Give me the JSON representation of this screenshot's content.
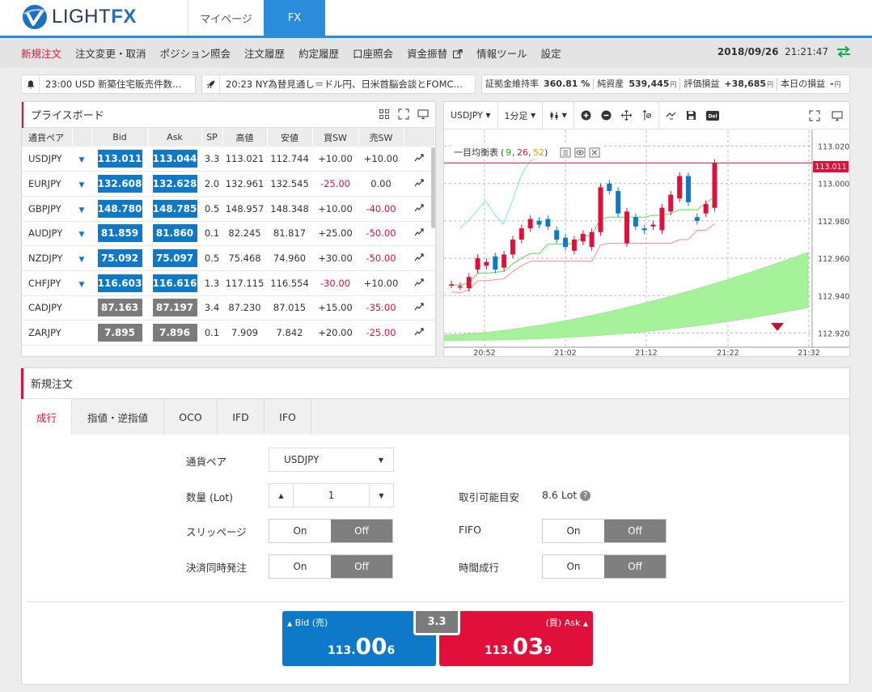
{
  "header": {
    "logo_text": "LIGHT",
    "logo_text_bold": "FX",
    "tabs": [
      {
        "label": "マイページ"
      },
      {
        "label": "FX"
      }
    ]
  },
  "nav": {
    "items": [
      "新規注文",
      "注文変更・取消",
      "ポジション照会",
      "注文履歴",
      "約定履歴",
      "口座照会",
      "資金振替",
      "情報ツール",
      "設定"
    ],
    "date": "2018/09/26",
    "time": "21:21:47"
  },
  "ticker": [
    {
      "text": "23:00 USD 新築住宅販売件数…"
    },
    {
      "text": "20:23 NY為替見通し＝ドル円、日米首脳会談とFOMC…"
    }
  ],
  "stats": {
    "margin_label": "証拠金維持率",
    "margin_value": "360.81 %",
    "equity_label": "純資産",
    "equity_value": "539,445",
    "equity_unit": "円",
    "pl_label": "評価損益",
    "pl_value": "+38,685",
    "pl_unit": "円",
    "today_label": "本日の損益",
    "today_value": "-",
    "today_unit": "円"
  },
  "price_board": {
    "title": "プライスボード",
    "columns": [
      "通貨ペア",
      "",
      "Bid",
      "Ask",
      "SP",
      "高値",
      "安値",
      "買SW",
      "売SW",
      ""
    ],
    "rows": [
      {
        "pair": "USDJPY",
        "arrow": true,
        "bid": "113.011",
        "ask": "113.044",
        "sp": "3.3",
        "high": "113.021",
        "low": "112.744",
        "buy_sw": "+10.00",
        "sell_sw": "+10.00",
        "active": true,
        "neg_buy": false,
        "neg_sell": false
      },
      {
        "pair": "EURJPY",
        "arrow": true,
        "bid": "132.608",
        "ask": "132.628",
        "sp": "2.0",
        "high": "132.961",
        "low": "132.545",
        "buy_sw": "-25.00",
        "sell_sw": "0.00",
        "active": true,
        "neg_buy": true,
        "neg_sell": false
      },
      {
        "pair": "GBPJPY",
        "arrow": true,
        "bid": "148.780",
        "ask": "148.785",
        "sp": "0.5",
        "high": "148.957",
        "low": "148.348",
        "buy_sw": "+10.00",
        "sell_sw": "-40.00",
        "active": true,
        "neg_buy": false,
        "neg_sell": true
      },
      {
        "pair": "AUDJPY",
        "arrow": true,
        "bid": "81.859",
        "ask": "81.860",
        "sp": "0.1",
        "high": "82.245",
        "low": "81.817",
        "buy_sw": "+25.00",
        "sell_sw": "-50.00",
        "active": true,
        "neg_buy": false,
        "neg_sell": true
      },
      {
        "pair": "NZDJPY",
        "arrow": true,
        "bid": "75.092",
        "ask": "75.097",
        "sp": "0.5",
        "high": "75.468",
        "low": "74.960",
        "buy_sw": "+30.00",
        "sell_sw": "-50.00",
        "active": true,
        "neg_buy": false,
        "neg_sell": true
      },
      {
        "pair": "CHFJPY",
        "arrow": true,
        "bid": "116.603",
        "ask": "116.616",
        "sp": "1.3",
        "high": "117.115",
        "low": "116.554",
        "buy_sw": "-30.00",
        "sell_sw": "+10.00",
        "active": true,
        "neg_buy": true,
        "neg_sell": false
      },
      {
        "pair": "CADJPY",
        "arrow": false,
        "bid": "87.163",
        "ask": "87.197",
        "sp": "3.4",
        "high": "87.230",
        "low": "87.015",
        "buy_sw": "+15.00",
        "sell_sw": "-35.00",
        "active": false,
        "neg_buy": false,
        "neg_sell": true
      },
      {
        "pair": "ZARJPY",
        "arrow": false,
        "bid": "7.895",
        "ask": "7.896",
        "sp": "0.1",
        "high": "7.909",
        "low": "7.842",
        "buy_sw": "+20.00",
        "sell_sw": "-25.00",
        "active": false,
        "neg_buy": false,
        "neg_sell": true
      }
    ]
  },
  "chart": {
    "symbol": "USDJPY",
    "timeframe": "1分足",
    "indicator_name": "一目均衡表",
    "indicator_params": [
      "9",
      "26",
      "52"
    ],
    "y_ticks": [
      "113.020",
      "113.000",
      "112.980",
      "112.960",
      "112.940",
      "112.920"
    ],
    "x_ticks": [
      "20:52",
      "21:02",
      "21:12",
      "21:22",
      "21:32"
    ],
    "current_price": "113.011",
    "ylim": [
      112.915,
      113.025
    ],
    "candles": [
      {
        "o": 112.946,
        "c": 112.946
      },
      {
        "o": 112.945,
        "c": 112.945
      },
      {
        "o": 112.944,
        "c": 112.95
      },
      {
        "o": 112.954,
        "c": 112.96
      },
      {
        "o": 112.956,
        "c": 112.958
      },
      {
        "o": 112.961,
        "c": 112.954
      },
      {
        "o": 112.955,
        "c": 112.962
      },
      {
        "o": 112.962,
        "c": 112.97
      },
      {
        "o": 112.97,
        "c": 112.976
      },
      {
        "o": 112.976,
        "c": 112.981
      },
      {
        "o": 112.98,
        "c": 112.978
      },
      {
        "o": 112.981,
        "c": 112.977
      },
      {
        "o": 112.975,
        "c": 112.97
      },
      {
        "o": 112.971,
        "c": 112.966
      },
      {
        "o": 112.964,
        "c": 112.97
      },
      {
        "o": 112.969,
        "c": 112.973
      },
      {
        "o": 112.966,
        "c": 112.974
      },
      {
        "o": 112.974,
        "c": 112.998
      },
      {
        "o": 113.0,
        "c": 112.996
      },
      {
        "o": 112.996,
        "c": 112.984
      },
      {
        "o": 112.968,
        "c": 112.985
      },
      {
        "o": 112.982,
        "c": 112.977
      },
      {
        "o": 112.976,
        "c": 112.975
      },
      {
        "o": 112.977,
        "c": 112.978
      },
      {
        "o": 112.975,
        "c": 112.987
      },
      {
        "o": 112.985,
        "c": 112.994
      },
      {
        "o": 112.992,
        "c": 113.004
      },
      {
        "o": 113.004,
        "c": 112.99
      },
      {
        "o": 112.982,
        "c": 112.98
      },
      {
        "o": 112.984,
        "c": 112.989
      },
      {
        "o": 112.987,
        "c": 113.011
      }
    ]
  },
  "order": {
    "title": "新規注文",
    "tabs": [
      "成行",
      "指値・逆指値",
      "OCO",
      "IFD",
      "IFO"
    ],
    "pair_label": "通貨ペア",
    "pair_value": "USDJPY",
    "qty_label": "数量 (Lot)",
    "qty_value": "1",
    "avail_label": "取引可能目安",
    "avail_value": "8.6 Lot",
    "slippage_label": "スリッページ",
    "fifo_label": "FIFO",
    "settle_label": "決済同時発注",
    "time_label": "時間成行",
    "on_label": "On",
    "off_label": "Off",
    "bid_caption": "Bid (売)",
    "ask_caption": "(買) Ask",
    "bid_price": [
      "113.",
      "00",
      "6"
    ],
    "ask_price": [
      "113.",
      "03",
      "9"
    ],
    "spread": "3.3"
  },
  "colors": {
    "accent_blue": "#2b8cdc",
    "bid_blue": "#0e78c9",
    "ask_red": "#e0103a",
    "cloud_green": "#a6f29a"
  }
}
